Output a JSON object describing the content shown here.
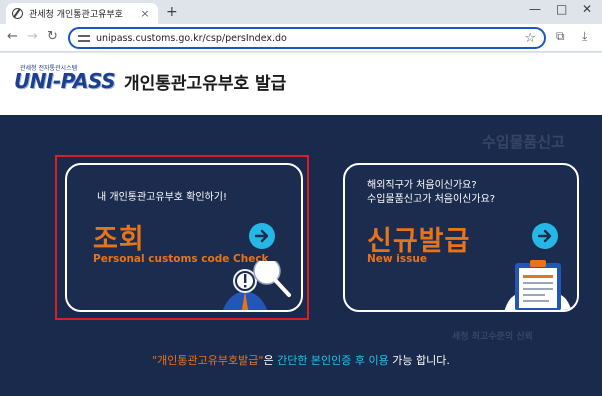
{
  "browser": {
    "tab_title": "관세청 개인통관고유부호",
    "tab_close": "×",
    "new_tab": "+",
    "url": "unipass.customs.go.kr/csp/persIndex.do"
  },
  "header": {
    "logo_top": "관세청  전자통관시스템",
    "logo_main": "UNI-PASS",
    "title": "개인통관고유부호  발급"
  },
  "cards": {
    "lookup": {
      "subtitle": "내 개인통관고유부호 확인하기!",
      "heading": "조회",
      "english": "Personal customs code Check"
    },
    "new_issue": {
      "subtitle": "해외직구가 처음이신가요?\n수입물품신고가 처음이신가요?",
      "heading": "신규발급",
      "english": "New issue"
    }
  },
  "footer": {
    "quote_open": "\"개인통관고유부호발급\"",
    "part1": "은 ",
    "highlight": "간단한 본인인증 후 이용",
    "part2": " 가능 합니다."
  },
  "background_text": {
    "top_right": "수입물품신고",
    "bottom_right": "세청 최고수준의 신뢰"
  },
  "colors": {
    "accent_orange": "#e8741a",
    "accent_cyan": "#25b8e6",
    "highlight_red": "#d61f26",
    "panel_bg": "#1a2a4d"
  }
}
